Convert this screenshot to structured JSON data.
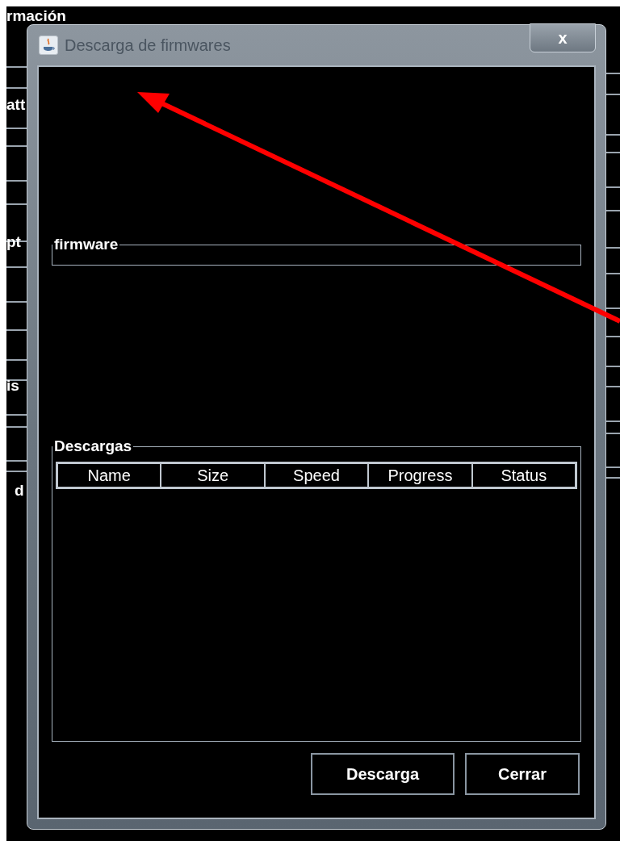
{
  "background_window": {
    "labels": [
      "rmación",
      "att",
      "pt",
      "is",
      "d"
    ]
  },
  "window": {
    "title": "Descarga de firmwares",
    "close": "x"
  },
  "firmware_group": {
    "title": "firmware"
  },
  "downloads_group": {
    "title": "Descargas",
    "table": {
      "columns": [
        "Name",
        "Size",
        "Speed",
        "Progress",
        "Status"
      ]
    }
  },
  "buttons": [
    "Descarga",
    "Cerrar"
  ]
}
